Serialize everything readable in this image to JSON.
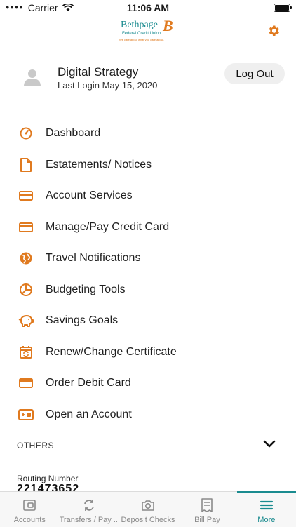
{
  "status_bar": {
    "carrier": "Carrier",
    "time": "11:06 AM"
  },
  "logo": {
    "name": "Bethpage",
    "mark": "B",
    "subtitle": "Federal Credit Union",
    "tagline": "We care about what you care about."
  },
  "profile": {
    "name": "Digital Strategy",
    "last_login": "Last Login May 15, 2020",
    "logout_label": "Log Out"
  },
  "menu": [
    {
      "label": "Dashboard",
      "icon": "dashboard-icon"
    },
    {
      "label": "Estatements/ Notices",
      "icon": "document-icon"
    },
    {
      "label": "Account Services",
      "icon": "card-icon"
    },
    {
      "label": "Manage/Pay Credit Card",
      "icon": "credit-card-icon"
    },
    {
      "label": "Travel Notifications",
      "icon": "globe-icon"
    },
    {
      "label": "Budgeting Tools",
      "icon": "pie-chart-icon"
    },
    {
      "label": "Savings Goals",
      "icon": "piggy-bank-icon"
    },
    {
      "label": "Renew/Change Certificate",
      "icon": "calendar-refresh-icon"
    },
    {
      "label": "Order Debit Card",
      "icon": "debit-card-icon"
    },
    {
      "label": "Open an Account",
      "icon": "open-account-icon"
    }
  ],
  "others": {
    "label": "OTHERS"
  },
  "routing": {
    "label": "Routing Number",
    "value": "221473652"
  },
  "tabs": [
    {
      "label": "Accounts",
      "icon": "wallet-icon",
      "active": false
    },
    {
      "label": "Transfers / Pay ...",
      "icon": "transfer-icon",
      "active": false
    },
    {
      "label": "Deposit Checks",
      "icon": "camera-icon",
      "active": false
    },
    {
      "label": "Bill Pay",
      "icon": "bill-icon",
      "active": false
    },
    {
      "label": "More",
      "icon": "menu-icon",
      "active": true
    }
  ],
  "colors": {
    "accent_orange": "#e07a1f",
    "brand_teal": "#1a8b8f"
  }
}
